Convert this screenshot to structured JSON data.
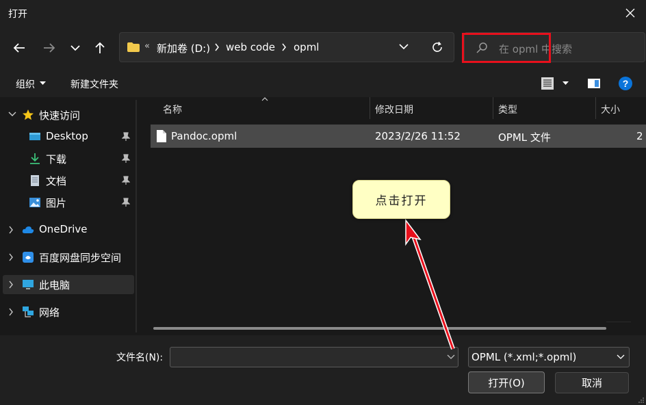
{
  "window": {
    "title": "打开"
  },
  "nav": {
    "breadcrumb": [
      {
        "label": "新加卷 (D:)"
      },
      {
        "label": "web code"
      },
      {
        "label": "opml"
      }
    ],
    "breadcrumb_overflow": "«",
    "search_placeholder": "在 opml 中搜索"
  },
  "toolbar": {
    "organize_label": "组织",
    "new_folder_label": "新建文件夹"
  },
  "sidebar": {
    "items": [
      {
        "label": "快速访问",
        "icon": "star-icon"
      },
      {
        "label": "Desktop",
        "icon": "desktop-icon"
      },
      {
        "label": "下载",
        "icon": "download-icon"
      },
      {
        "label": "文档",
        "icon": "document-icon"
      },
      {
        "label": "图片",
        "icon": "pictures-icon"
      },
      {
        "label": "OneDrive",
        "icon": "cloud-icon"
      },
      {
        "label": "百度网盘同步空间",
        "icon": "baidu-netdisk-icon"
      },
      {
        "label": "此电脑",
        "icon": "computer-icon"
      },
      {
        "label": "网络",
        "icon": "network-icon"
      }
    ]
  },
  "file_list": {
    "columns": [
      "名称",
      "修改日期",
      "类型",
      "大小"
    ],
    "rows": [
      {
        "name": "Pandoc.opml",
        "modified": "2023/2/26 11:52",
        "type": "OPML 文件",
        "size": "2"
      }
    ]
  },
  "bottom": {
    "filename_label": "文件名(N):",
    "filename_value": "",
    "filetype_label": "OPML (*.xml;*.opml)",
    "open_label": "打开(O)",
    "cancel_label": "取消"
  },
  "annotation": {
    "callout_text": "点击打开",
    "highlight_color": "#e8101c",
    "callout_color": "#ffffc4"
  },
  "colors": {
    "background": "#191919",
    "chrome": "#202020",
    "selected_row": "#4a4a4a",
    "help_blue": "#0a74da",
    "folder_yellow": "#f2c94c"
  }
}
